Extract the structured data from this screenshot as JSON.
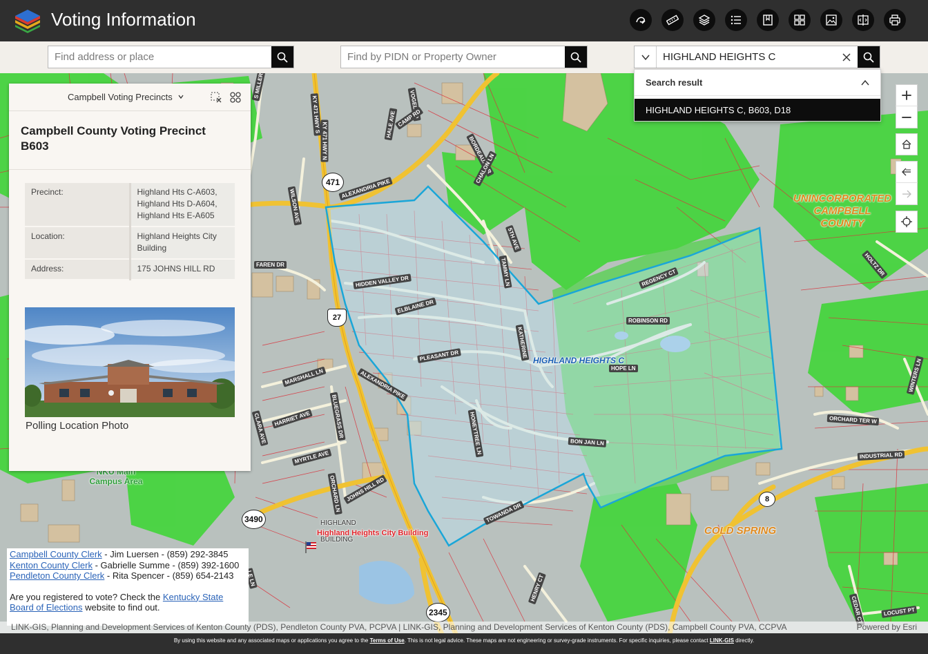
{
  "app": {
    "title": "Voting Information",
    "colors": {
      "header_bg": "#2f2f2f",
      "accent": "#0d0d0d",
      "precinct_outline": "#1aa6d8",
      "parcel_line": "#d9323c",
      "vegetation": "#3ed83b"
    }
  },
  "header_tools": [
    {
      "icon": "sketch-icon"
    },
    {
      "icon": "measure-icon"
    },
    {
      "icon": "layers-icon"
    },
    {
      "icon": "legend-list-icon"
    },
    {
      "icon": "bookmark-icon"
    },
    {
      "icon": "basemap-gallery-icon"
    },
    {
      "icon": "image-export-icon"
    },
    {
      "icon": "swipe-compare-icon"
    },
    {
      "icon": "print-icon"
    }
  ],
  "search": {
    "address_placeholder": "Find address or place",
    "pidn_placeholder": "Find by PIDN or Property Owner",
    "precinct_value": "HIGHLAND HEIGHTS C",
    "results_header": "Search result",
    "results": [
      "HIGHLAND HEIGHTS C, B603, D18"
    ]
  },
  "panel": {
    "layer_select": "Campbell Voting Precincts",
    "title": "Campbell County Voting Precinct B603",
    "attributes": [
      {
        "key": "Precinct:",
        "value_lines": [
          "Highland Hts C-A603,",
          "Highland Hts D-A604,",
          "Highland Hts E-A605"
        ]
      },
      {
        "key": "Location:",
        "value_lines": [
          "Highland Heights City",
          "Building"
        ]
      },
      {
        "key": "Address:",
        "value_lines": [
          "175 JOHNS HILL RD"
        ]
      }
    ],
    "photo_caption": "Polling Location Photo"
  },
  "map_labels": {
    "precinct": "HIGHLAND HEIGHTS C",
    "unincorporated": [
      "UNINCORPORATED",
      "CAMPBELL",
      "COUNTY"
    ],
    "cold_spring": "COLD SPRING",
    "nku": [
      "NKU Main",
      "Campus Area"
    ],
    "city_building": "Highland Heights City Building",
    "highland": "HIGHLAND",
    "building": "BUILDING",
    "shields": [
      "471",
      "27",
      "3490",
      "2345",
      "8"
    ],
    "roads": [
      "S MILLER AVE",
      "KY 471 HWY S",
      "KY 471 HWY N",
      "VOGEL RD",
      "CAMP RD",
      "HALE AVE",
      "BORDEAUX DR",
      "WILSON AVE",
      "ALEXANDRIA PIKE",
      "CHALON LN",
      "5TH AVE",
      "TAMMY LN",
      "FAREN DR",
      "HIDDEN VALLEY DR",
      "ELBLAINE DR",
      "KATHERINE",
      "REGENCY CT",
      "ROBINSON RD",
      "HOPE LN",
      "PLEASANT DR",
      "ALEXANDRIA PIKE",
      "MARSHALL LN",
      "BLUEGRASS DR",
      "CLARA AVE",
      "HARRIET AVE",
      "HONEYTREE LN",
      "BON JAN LN",
      "MYRTLE AVE",
      "ORCHARD LN",
      "JOHNS HILL RD",
      "TOWANDA DR",
      "HOLTZ DR",
      "ORCHARD TER W",
      "INDUSTRIAL RD",
      "WINTERS LN",
      "HENRY CT",
      "CEDAR CT",
      "LOCUST PT",
      "LE LN"
    ]
  },
  "clerks": [
    {
      "link": "Campbell County Clerk",
      "text": " - Jim Luersen - (859) 292-3845"
    },
    {
      "link": "Kenton County Clerk",
      "text": " - Gabrielle Summe - (859) 392-1600"
    },
    {
      "link": "Pendleton County Clerk",
      "text": " - Rita Spencer - (859) 654-2143"
    }
  ],
  "register": {
    "pre": "Are you registered to vote? Check the ",
    "link": "Kentucky State Board of Elections",
    "post": " website to find out."
  },
  "attribution": "LINK-GIS, Planning and Development Services of Kenton County (PDS), Pendleton County PVA, PCPVA | LINK-GIS, Planning and Development Services of Kenton County (PDS), Campbell County PVA, CCPVA",
  "powered_by": "Powered by Esri",
  "footer": {
    "pre": "By using this website and any associated maps or applications you agree to the ",
    "terms": "Terms of Use",
    "mid": ". This is not legal advice. These maps are not engineering or survey-grade instruments. For specific inquiries, please contact ",
    "contact": "LINK-GIS",
    "post": " directly."
  }
}
